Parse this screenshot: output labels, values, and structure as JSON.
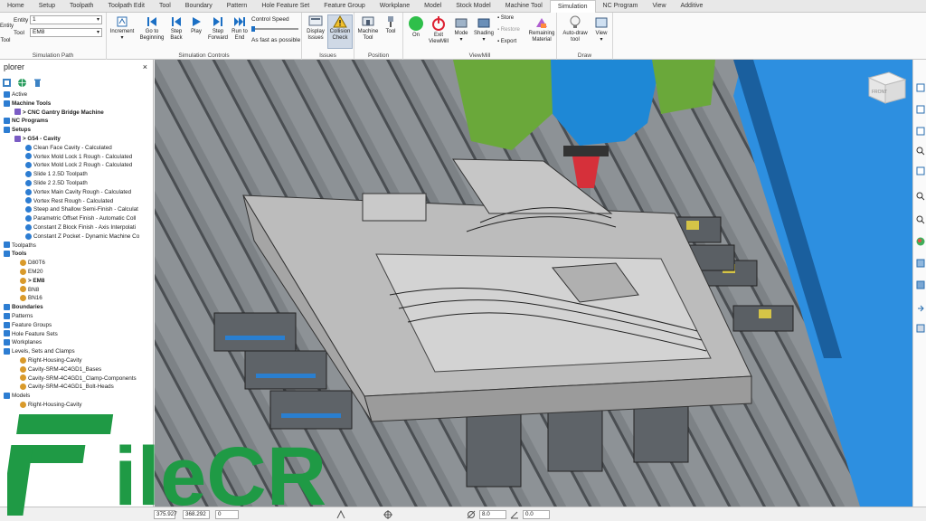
{
  "ribbon_tabs": [
    "Home",
    "Setup",
    "Toolpath",
    "Toolpath Edit",
    "Tool",
    "Boundary",
    "Pattern",
    "Hole Feature Set",
    "Feature Group",
    "Workplane",
    "Model",
    "Stock Model",
    "Machine Tool",
    "Simulation",
    "NC Program",
    "View",
    "Additive"
  ],
  "active_tab": "Simulation",
  "sim_path": {
    "entity_button": "Entity",
    "tool_button": "Tool",
    "entity_label": "Entity",
    "entity_value": "1",
    "tool_label": "Tool",
    "tool_value": "EM8",
    "group_label": "Simulation Path"
  },
  "sim_controls": {
    "increment": "Increment",
    "go_to_beginning": "Go to Beginning",
    "step_back": "Step Back",
    "play": "Play",
    "step_forward": "Step Forward",
    "run_to_end": "Run to End",
    "control_speed_label": "Control Speed",
    "speed_value": "As fast as possible",
    "group_label": "Simulation Controls"
  },
  "issues": {
    "display_issues": "Display Issues",
    "collision_check": "Collision Check",
    "group_label": "Issues"
  },
  "position": {
    "machine_tool": "Machine Tool",
    "tool": "Tool",
    "group_label": "Position"
  },
  "viewmill": {
    "on": "On",
    "exit_viewmill": "Exit ViewMill",
    "mode": "Mode",
    "shading": "Shading",
    "store": "Store",
    "restore": "Restore",
    "export": "Export",
    "remaining_material": "Remaining Material",
    "group_label": "ViewMill"
  },
  "draw": {
    "auto_draw_tool": "Auto-draw tool",
    "view": "View",
    "group_label": "Draw"
  },
  "explorer": {
    "title": "plorer",
    "close": "×",
    "items": [
      {
        "text": "Active",
        "bold": false,
        "indent": 0
      },
      {
        "text": "Machine Tools",
        "bold": true,
        "indent": 0
      },
      {
        "text": "> CNC Gantry Bridge Machine",
        "bold": true,
        "indent": 2
      },
      {
        "text": "NC Programs",
        "bold": true,
        "indent": 0
      },
      {
        "text": "Setups",
        "bold": true,
        "indent": 0
      },
      {
        "text": "> G54 - Cavity",
        "bold": true,
        "indent": 2
      },
      {
        "text": "Clean Face Cavity - Calculated",
        "bold": false,
        "indent": 4
      },
      {
        "text": "Vortex Mold Lock 1 Rough - Calculated",
        "bold": false,
        "indent": 4
      },
      {
        "text": "Vortex Mold Lock 2 Rough - Calculated",
        "bold": false,
        "indent": 4
      },
      {
        "text": "Slide 1 2.5D Toolpath",
        "bold": false,
        "indent": 4
      },
      {
        "text": "Slide 2 2.5D Toolpath",
        "bold": false,
        "indent": 4
      },
      {
        "text": "Vortex Main Cavity Rough - Calculated",
        "bold": false,
        "indent": 4
      },
      {
        "text": "Vortex Rest Rough - Calculated",
        "bold": false,
        "indent": 4
      },
      {
        "text": "Steep and Shallow Semi-Finish - Calculat",
        "bold": false,
        "indent": 4
      },
      {
        "text": "Parametric Offset Finish - Automatic Coll",
        "bold": false,
        "indent": 4
      },
      {
        "text": "Constant Z Block Finish - Axis Interpolati",
        "bold": false,
        "indent": 4
      },
      {
        "text": "Constant Z Pocket - Dynamic Machine Co",
        "bold": false,
        "indent": 4
      },
      {
        "text": "Toolpaths",
        "bold": false,
        "indent": 0
      },
      {
        "text": "Tools",
        "bold": true,
        "indent": 0
      },
      {
        "text": "D80T6",
        "bold": false,
        "indent": 3
      },
      {
        "text": "EM20",
        "bold": false,
        "indent": 3
      },
      {
        "text": "> EM8",
        "bold": true,
        "indent": 3
      },
      {
        "text": "BN8",
        "bold": false,
        "indent": 3
      },
      {
        "text": "BN16",
        "bold": false,
        "indent": 3
      },
      {
        "text": "Boundaries",
        "bold": true,
        "indent": 0
      },
      {
        "text": "Patterns",
        "bold": false,
        "indent": 0
      },
      {
        "text": "Feature Groups",
        "bold": false,
        "indent": 0
      },
      {
        "text": "Hole Feature Sets",
        "bold": false,
        "indent": 0
      },
      {
        "text": "Workplanes",
        "bold": false,
        "indent": 0
      },
      {
        "text": "Levels, Sets and Clamps",
        "bold": false,
        "indent": 0
      },
      {
        "text": "Right-Housing-Cavity",
        "bold": false,
        "indent": 3
      },
      {
        "text": "Cavity-SRM-4C4GD1_Bases",
        "bold": false,
        "indent": 3
      },
      {
        "text": "Cavity-SRM-4C4GD1_Clamp-Components",
        "bold": false,
        "indent": 3
      },
      {
        "text": "Cavity-SRM-4C4GD1_Bolt-Heads",
        "bold": false,
        "indent": 3
      },
      {
        "text": "Models",
        "bold": false,
        "indent": 0
      },
      {
        "text": "Right-Housing-Cavity",
        "bold": false,
        "indent": 3
      }
    ]
  },
  "viewcube_label": "FRONT",
  "status": {
    "x": "375.927",
    "y": "368.292",
    "z": "0",
    "diameter": "8.0",
    "angle": "0.0"
  },
  "watermark": "FileCR"
}
